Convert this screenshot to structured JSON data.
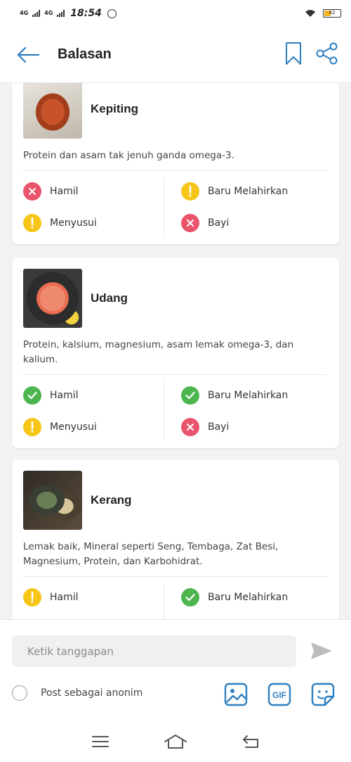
{
  "status_bar": {
    "network1": "4G",
    "network2": "4G",
    "time": "18:54",
    "battery_level": "42"
  },
  "header": {
    "title": "Balasan"
  },
  "cards": [
    {
      "name": "Kepiting",
      "description": "Protein dan asam tak jenuh ganda omega-3.",
      "statuses": [
        {
          "label": "Hamil",
          "status": "no"
        },
        {
          "label": "Baru Melahirkan",
          "status": "warn"
        },
        {
          "label": "Menyusui",
          "status": "warn"
        },
        {
          "label": "Bayi",
          "status": "no"
        }
      ]
    },
    {
      "name": "Udang",
      "description": "Protein, kalsium, magnesium, asam lemak omega-3, dan kalium.",
      "statuses": [
        {
          "label": "Hamil",
          "status": "ok"
        },
        {
          "label": "Baru Melahirkan",
          "status": "ok"
        },
        {
          "label": "Menyusui",
          "status": "warn"
        },
        {
          "label": "Bayi",
          "status": "no"
        }
      ]
    },
    {
      "name": "Kerang",
      "description": "Lemak baik, Mineral seperti Seng, Tembaga, Zat Besi, Magnesium, Protein, dan Karbohidrat.",
      "statuses": [
        {
          "label": "Hamil",
          "status": "warn"
        },
        {
          "label": "Baru Melahirkan",
          "status": "ok"
        },
        {
          "label": "",
          "status": "ok"
        },
        {
          "label": "",
          "status": "no"
        }
      ]
    }
  ],
  "reply": {
    "placeholder": "Ketik tanggapan",
    "anon_label": "Post sebagai anonim"
  },
  "colors": {
    "accent": "#2d7fc1",
    "no": "#e8546b",
    "warn": "#f5c518",
    "ok": "#4db54d"
  },
  "icons": {
    "media": [
      "image-icon",
      "gif-icon",
      "sticker-icon"
    ],
    "gif_text": "GIF"
  }
}
